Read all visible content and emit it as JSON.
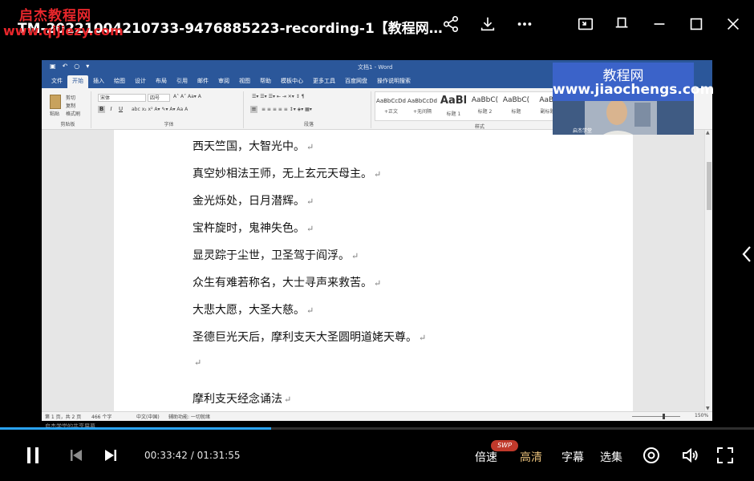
{
  "player": {
    "watermark_top": "启杰教程网",
    "watermark_url": "www.qijiezy.com",
    "title": "TM-20221004210733-9476885223-recording-1【教程网www.jiao...",
    "sub_caption": "启杰学堂的共享屏幕",
    "progress_fraction": 0.36,
    "time_current": "00:33:42",
    "time_separator": "/",
    "time_total": "01:31:55",
    "speed_label": "倍速",
    "speed_badge": "SWP",
    "quality_label": "高清",
    "subtitle_label": "字幕",
    "episodes_label": "选集",
    "accent_color": "#2aa3f5",
    "quality_color": "#e7bf7a",
    "icons": {
      "share": "share-icon",
      "download": "download-icon",
      "more": "more-icon",
      "pip": "pip-icon",
      "pin": "pin-icon",
      "minimize": "minimize-icon",
      "maximize": "maximize-icon",
      "close": "close-icon",
      "play_pause": "pause-icon",
      "prev": "previous-icon",
      "next": "next-icon",
      "danmaku": "target-icon",
      "volume": "volume-icon",
      "fullscreen": "fullscreen-icon",
      "side": "chevron-left-icon"
    }
  },
  "brand_overlay": {
    "cn": "教程网",
    "url": "www.jiaochengs.com",
    "cam_label": "启杰学堂",
    "color": "#3b63c9"
  },
  "word": {
    "doc_title": "文档1 - Word",
    "tabs": [
      "文件",
      "开始",
      "插入",
      "绘图",
      "设计",
      "布局",
      "引用",
      "邮件",
      "审阅",
      "视图",
      "帮助",
      "模板中心",
      "更多工具",
      "百度网盘",
      "操作说明搜索"
    ],
    "active_tab_index": 1,
    "clipboard": {
      "paste": "粘贴",
      "cut": "剪切",
      "copy": "复制",
      "format_painter": "格式刷",
      "group": "剪贴板"
    },
    "font": {
      "name": "宋体",
      "size": "四号",
      "group": "字体"
    },
    "paragraph_group": "段落",
    "styles_group": "样式",
    "styles": [
      {
        "preview": "AaBbCcDd",
        "name": "+正文",
        "kind": "small"
      },
      {
        "preview": "AaBbCcDd",
        "name": "+无间隔",
        "kind": "small"
      },
      {
        "preview": "AaBl",
        "name": "标题 1",
        "kind": "big"
      },
      {
        "preview": "AaBbC(",
        "name": "标题 2",
        "kind": "mid"
      },
      {
        "preview": "AaBbC(",
        "name": "标题",
        "kind": "mid"
      },
      {
        "preview": "AaBl",
        "name": "副标题",
        "kind": "mid"
      }
    ],
    "lines": [
      "西天竺国，大智光中。",
      "真空妙相法王师，无上玄元天母主。",
      "金光烁处，日月潜辉。",
      "宝杵旋时，鬼神失色。",
      "显灵踪于尘世，卫圣驾于阎浮。",
      "众生有难若称名，大士寻声来救苦。",
      "大悲大愿，大圣大慈。",
      "圣德巨光天后，摩利支天大圣圆明道姥天尊。",
      "",
      "摩利支天经念诵法"
    ],
    "return_mark": "↵",
    "status": {
      "page": "第 1 页，共 2 页",
      "words": "466 个字",
      "lang": "中文(中国)",
      "accessibility": "辅助功能: 一切就绪",
      "zoom": "150%"
    }
  }
}
